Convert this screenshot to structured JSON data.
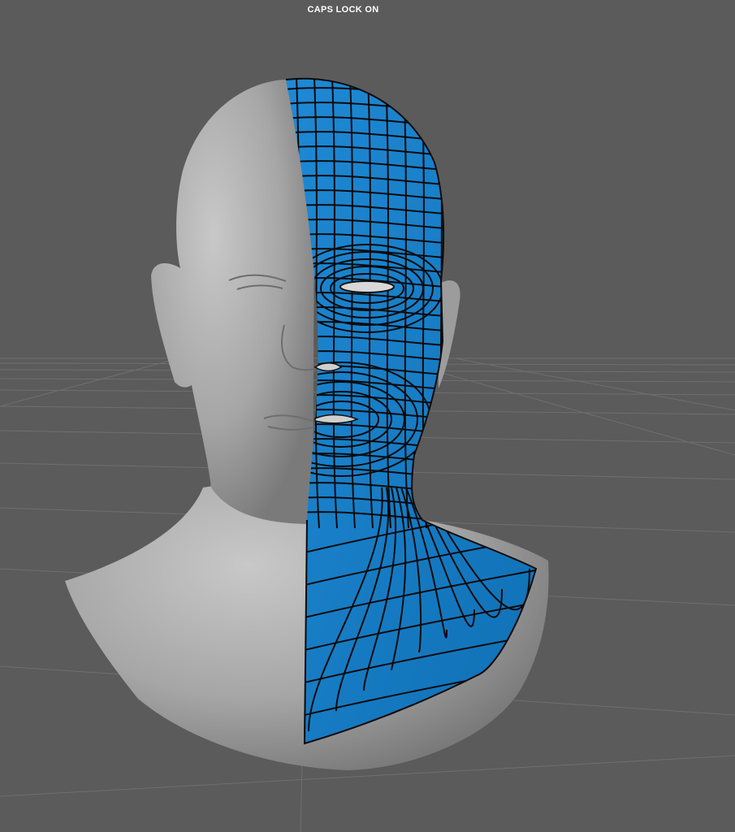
{
  "viewport": {
    "status_text": "CAPS LOCK ON",
    "background_color": "#5b5b5b",
    "grid_color": "#6e6e6e",
    "model": {
      "name": "head-bust",
      "sculpt_color": "#a9a9a9",
      "retopo_color": "#1a7fc9",
      "wire_color": "#0d0d0d"
    }
  }
}
